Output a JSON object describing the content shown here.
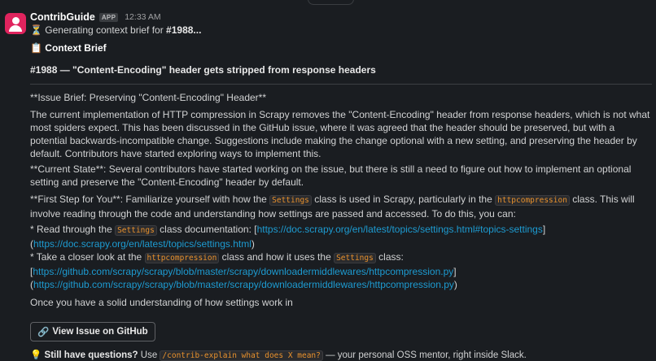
{
  "message": {
    "sender": "ContribGuide",
    "badge": "APP",
    "time": "12:33 AM",
    "generating_prefix": "Generating context brief for ",
    "generating_issue": "#1988...",
    "brief_title": "Context Brief",
    "issue_title": "#1988 — \"Content-Encoding\" header gets stripped from response headers"
  },
  "body": {
    "p1": "**Issue Brief: Preserving \"Content-Encoding\" Header**",
    "p2": "The current implementation of HTTP compression in Scrapy removes the \"Content-Encoding\" header from response headers, which is not what most spiders expect. This has been discussed in the GitHub issue, where it was agreed that the header should be preserved, but with a potential backwards-incompatible change. Suggestions include making the change optional with a new setting, and preserving the header by default. Contributors have started exploring ways to implement this.",
    "p3": "**Current State**: Several contributors have started working on the issue, but there is still a need to figure out how to implement an optional setting and preserve the \"Content-Encoding\" header by default.",
    "p4_a": "**First Step for You**: Familiarize yourself with how the ",
    "p4_code1": "Settings",
    "p4_b": " class is used in Scrapy, particularly in the ",
    "p4_code2": "httpcompression",
    "p4_c": " class. This will involve reading through the code and understanding how settings are passed and accessed. To do this, you can:",
    "bullet1_a": "* Read through the ",
    "bullet1_code": "Settings",
    "bullet1_b": " class documentation: [",
    "bullet1_link1": "https://doc.scrapy.org/en/latest/topics/settings.html#topics-settings",
    "bullet1_c": "]",
    "bullet1_link2": "https://doc.scrapy.org/en/latest/topics/settings.html",
    "bullet2_a": "* Take a closer look at the ",
    "bullet2_code1": "httpcompression",
    "bullet2_b": " class and how it uses the ",
    "bullet2_code2": "Settings",
    "bullet2_c": " class:",
    "bullet2_link1": "https://github.com/scrapy/scrapy/blob/master/scrapy/downloadermiddlewares/httpcompression.py",
    "bullet2_link2": "https://github.com/scrapy/scrapy/blob/master/scrapy/downloadermiddlewares/httpcompression.py",
    "p6": "Once you have a solid understanding of how settings work in"
  },
  "button": {
    "label": "View Issue on GitHub"
  },
  "footer": {
    "bold": "Still have questions?",
    "use": " Use ",
    "command": "/contrib-explain what does X mean?",
    "rest": " — your personal OSS mentor, right inside Slack."
  },
  "icons": {
    "hourglass": "hourglass-icon",
    "clipboard": "clipboard-icon",
    "link": "link-icon",
    "bulb": "lightbulb-icon"
  }
}
